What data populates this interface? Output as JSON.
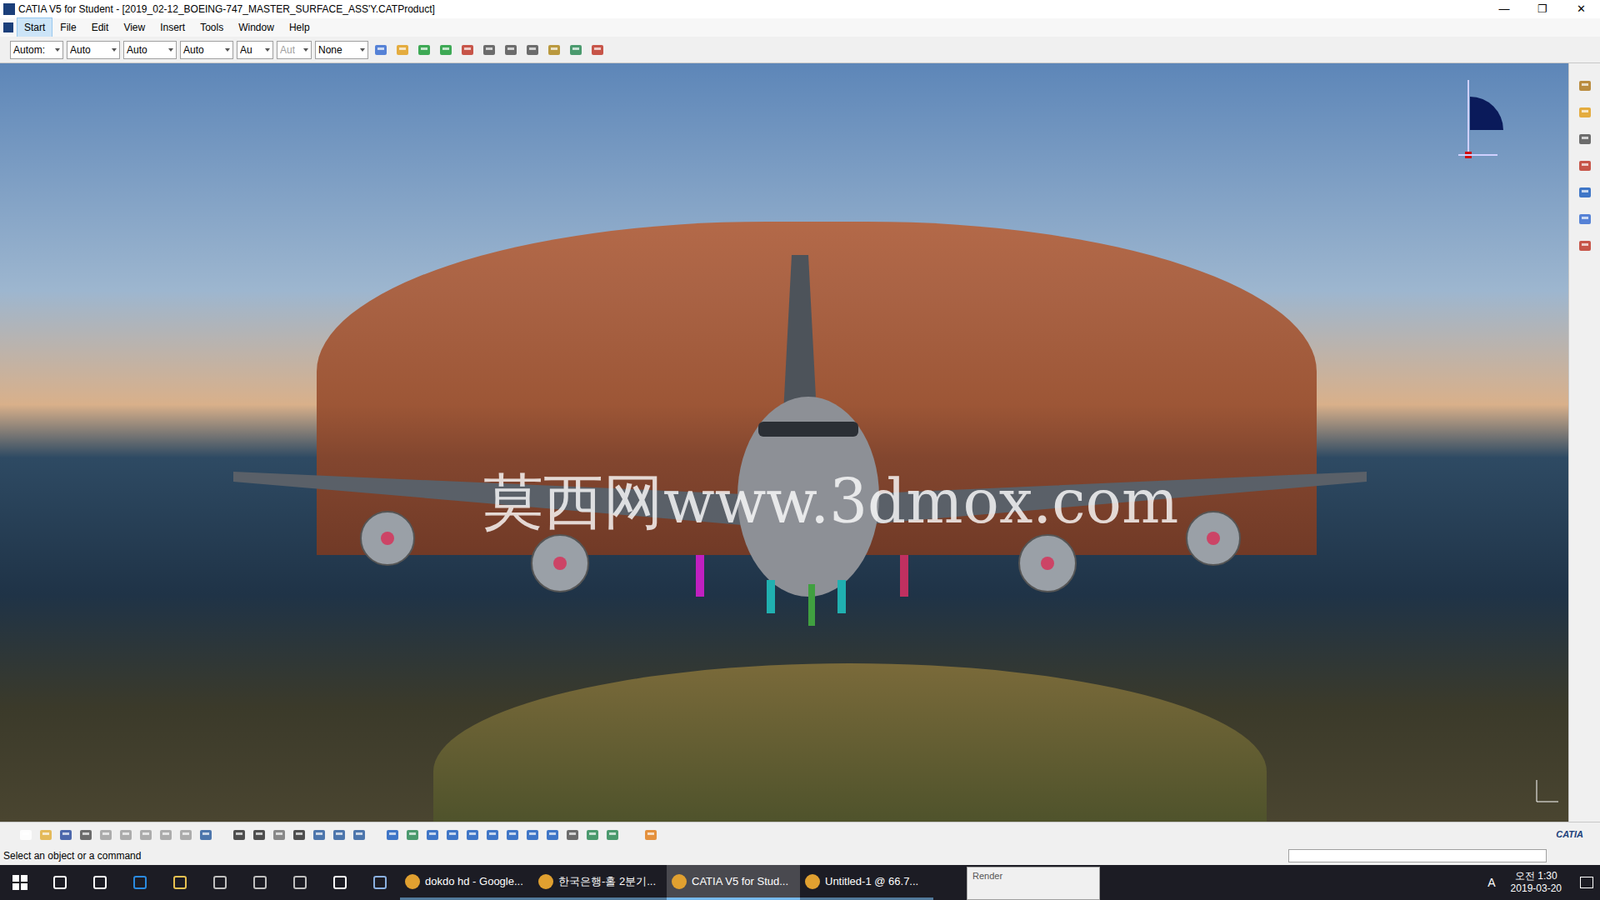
{
  "window": {
    "title": "CATIA V5 for Student - [2019_02-12_BOEING-747_MASTER_SURFACE_ASS'Y.CATProduct]",
    "controls": [
      "—",
      "❐",
      "✕"
    ]
  },
  "menu": [
    {
      "label": "Start",
      "selected": true
    },
    {
      "label": "File",
      "selected": false
    },
    {
      "label": "Edit",
      "selected": false
    },
    {
      "label": "View",
      "selected": false
    },
    {
      "label": "Insert",
      "selected": false
    },
    {
      "label": "Tools",
      "selected": false
    },
    {
      "label": "Window",
      "selected": false
    },
    {
      "label": "Help",
      "selected": false
    }
  ],
  "toolbar": {
    "dropdowns": [
      {
        "value": "Autom:",
        "disabled": false
      },
      {
        "value": "Auto",
        "disabled": false
      },
      {
        "value": "Auto",
        "disabled": false
      },
      {
        "value": "Auto",
        "disabled": false
      },
      {
        "value": "Au",
        "disabled": false
      },
      {
        "value": "Aut",
        "disabled": true
      },
      {
        "value": "None",
        "disabled": false
      }
    ]
  },
  "viewport": {
    "watermark": "莫西网www.3dmox.com"
  },
  "brand": "CATIA",
  "status_bar": {
    "prompt": "Select an object or a command"
  },
  "render_panel": {
    "title": "Render"
  },
  "taskbar": {
    "apps": [
      {
        "label": "dokdo hd - Google...",
        "selected": false
      },
      {
        "label": "한국은행-홀 2분기...",
        "selected": false
      },
      {
        "label": "CATIA V5 for Stud...",
        "selected": true
      },
      {
        "label": "Untitled-1 @ 66.7...",
        "selected": false
      }
    ],
    "tray": {
      "ime": "A",
      "time": "오전 1:30",
      "date": "2019-03-20"
    }
  }
}
